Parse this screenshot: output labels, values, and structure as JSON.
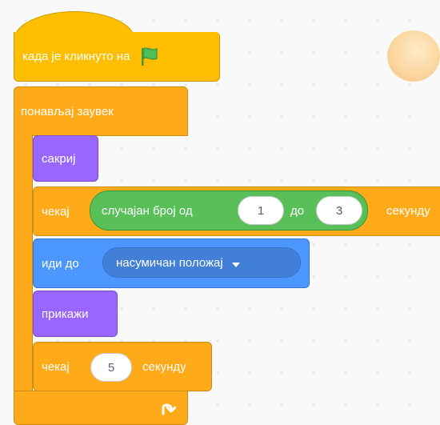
{
  "script": {
    "when_flag_clicked": "када је кликнуто на",
    "forever": "понављај заувек",
    "hide": "сакриј",
    "wait_label": "чекај",
    "random_label": "случајан број од",
    "random_from": "1",
    "random_to_label": "до",
    "random_to": "3",
    "seconds_label": "секунду",
    "goto_label": "иди до",
    "goto_target": "насумичан положај",
    "show": "прикажи",
    "wait2_label": "чекај",
    "wait2_value": "5",
    "wait2_seconds": "секунду"
  },
  "icons": {
    "flag": "green-flag-icon",
    "loop_arrow": "loop-arrow-icon",
    "dropdown_arrow": "dropdown-caret-icon"
  },
  "colors": {
    "events": "#ffbf00",
    "control": "#ffab19",
    "looks": "#9966ff",
    "motion": "#4c97ff",
    "operators": "#59c059"
  }
}
